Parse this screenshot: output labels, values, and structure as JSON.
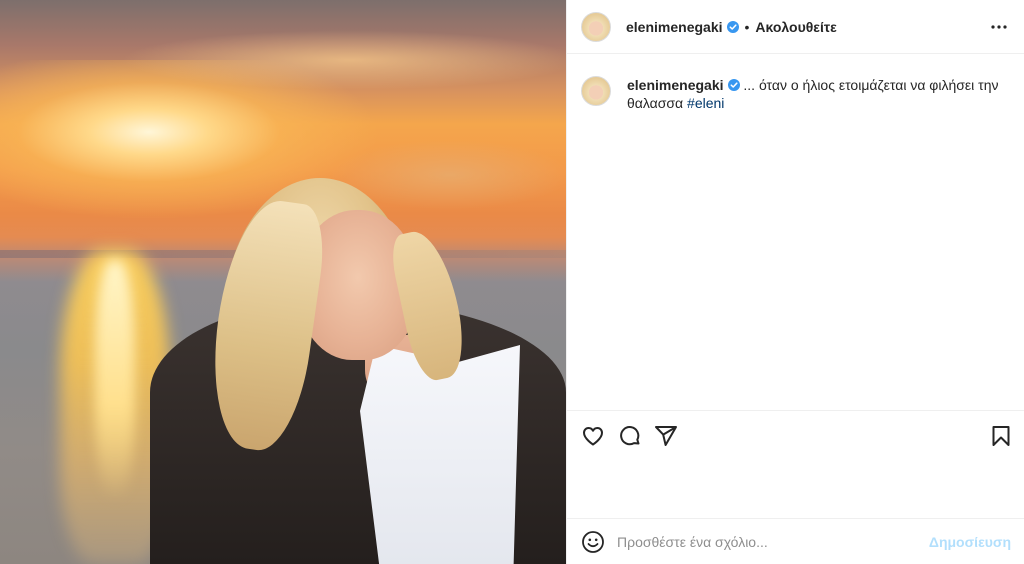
{
  "post": {
    "username": "elenimenegaki",
    "follow_separator": "•",
    "follow_status": "Ακολουθείτε",
    "caption_text": "... όταν ο ήλιος ετοιμάζεται να φιλήσει την θαλασσα",
    "caption_hashtag": "#eleni"
  },
  "comment": {
    "placeholder": "Προσθέστε ένα σχόλιο...",
    "post_label": "Δημοσίευση"
  },
  "icons": {
    "verified": "verified-badge-icon",
    "more": "more-options-icon",
    "like": "heart-icon",
    "comment": "comment-bubble-icon",
    "share": "paper-plane-icon",
    "save": "bookmark-icon",
    "emoji": "emoji-smile-icon"
  },
  "colors": {
    "verified": "#3897f0",
    "hashtag": "#00376b",
    "post_disabled": "#b2dffc"
  }
}
